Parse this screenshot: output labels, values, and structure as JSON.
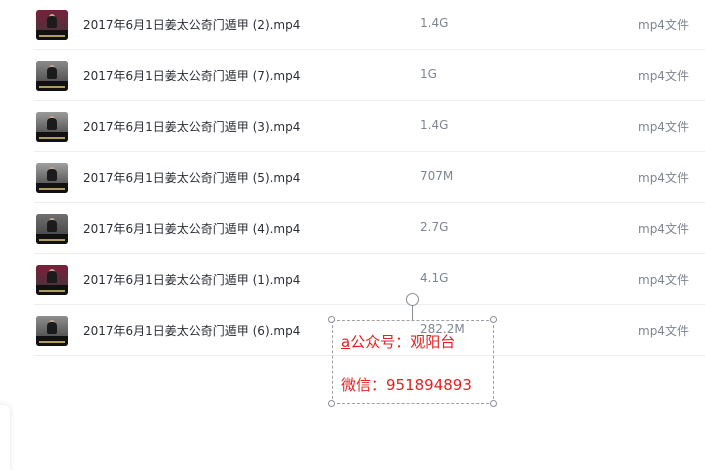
{
  "files": [
    {
      "name": "2017年6月1日姜太公奇门遁甲 (2).mp4",
      "size": "1.4G",
      "type": "mp4文件",
      "thumb_color": "#7a1f3a"
    },
    {
      "name": "2017年6月1日姜太公奇门遁甲 (7).mp4",
      "size": "1G",
      "type": "mp4文件",
      "thumb_color": "#8a8a8a"
    },
    {
      "name": "2017年6月1日姜太公奇门遁甲 (3).mp4",
      "size": "1.4G",
      "type": "mp4文件",
      "thumb_color": "#9a9a9a"
    },
    {
      "name": "2017年6月1日姜太公奇门遁甲 (5).mp4",
      "size": "707M",
      "type": "mp4文件",
      "thumb_color": "#a0a0a0"
    },
    {
      "name": "2017年6月1日姜太公奇门遁甲 (4).mp4",
      "size": "2.7G",
      "type": "mp4文件",
      "thumb_color": "#6f6f6f"
    },
    {
      "name": "2017年6月1日姜太公奇门遁甲 (1).mp4",
      "size": "4.1G",
      "type": "mp4文件",
      "thumb_color": "#7a1f3a"
    },
    {
      "name": "2017年6月1日姜太公奇门遁甲 (6).mp4",
      "size": "282.2M",
      "type": "mp4文件",
      "thumb_color": "#8e8e8e"
    }
  ],
  "watermark": {
    "line1_prefix": "a",
    "line1_rest": "公众号：观阳台",
    "line2": "微信：951894893",
    "color": "#e02222"
  }
}
